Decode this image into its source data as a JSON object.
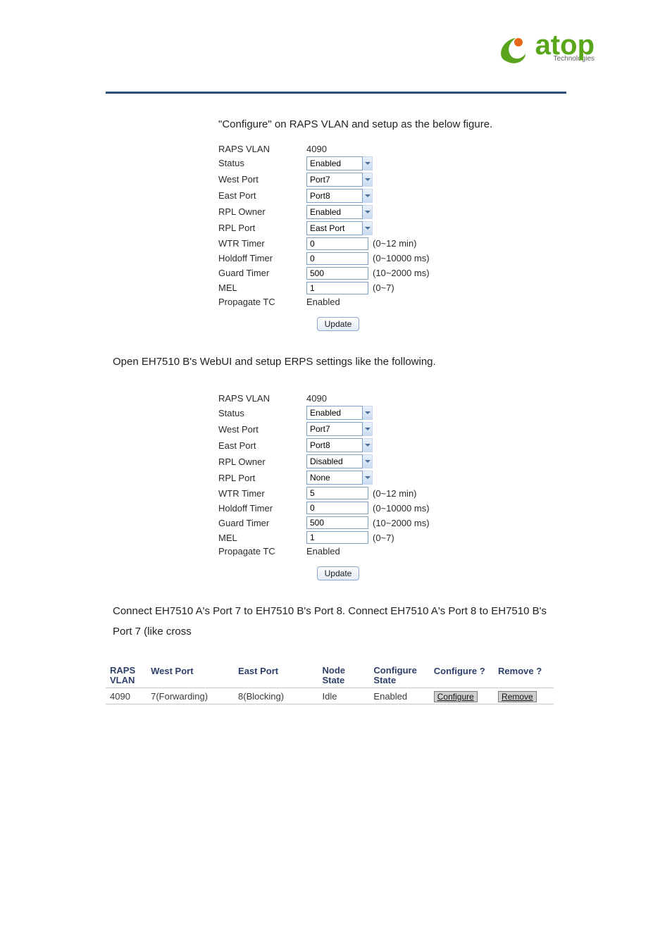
{
  "brand": {
    "name": "atop",
    "sub": "Technologies"
  },
  "text": {
    "intro1": "\"Configure\" on RAPS VLAN and setup as the below figure.",
    "intro2": "Open EH7510 B's WebUI and setup ERPS settings like the following.",
    "intro3": "Connect EH7510 A's Port 7 to EH7510 B's Port 8. Connect EH7510 A's Port 8 to EH7510 B's Port 7 (like cross"
  },
  "formA": {
    "raps_vlan": {
      "label": "RAPS VLAN",
      "value": "4090"
    },
    "status": {
      "label": "Status",
      "value": "Enabled"
    },
    "west_port": {
      "label": "West Port",
      "value": "Port7"
    },
    "east_port": {
      "label": "East Port",
      "value": "Port8"
    },
    "rpl_owner": {
      "label": "RPL Owner",
      "value": "Enabled"
    },
    "rpl_port": {
      "label": "RPL Port",
      "value": "East Port"
    },
    "wtr_timer": {
      "label": "WTR Timer",
      "value": "0",
      "hint": "(0~12 min)"
    },
    "holdoff": {
      "label": "Holdoff Timer",
      "value": "0",
      "hint": "(0~10000 ms)"
    },
    "guard": {
      "label": "Guard Timer",
      "value": "500",
      "hint": "(10~2000 ms)"
    },
    "mel": {
      "label": "MEL",
      "value": "1",
      "hint": "(0~7)"
    },
    "propagate": {
      "label": "Propagate TC",
      "value": "Enabled"
    },
    "update": "Update"
  },
  "formB": {
    "raps_vlan": {
      "label": "RAPS VLAN",
      "value": "4090"
    },
    "status": {
      "label": "Status",
      "value": "Enabled"
    },
    "west_port": {
      "label": "West Port",
      "value": "Port7"
    },
    "east_port": {
      "label": "East Port",
      "value": "Port8"
    },
    "rpl_owner": {
      "label": "RPL Owner",
      "value": "Disabled"
    },
    "rpl_port": {
      "label": "RPL Port",
      "value": "None"
    },
    "wtr_timer": {
      "label": "WTR Timer",
      "value": "5",
      "hint": "(0~12 min)"
    },
    "holdoff": {
      "label": "Holdoff Timer",
      "value": "0",
      "hint": "(0~10000 ms)"
    },
    "guard": {
      "label": "Guard Timer",
      "value": "500",
      "hint": "(10~2000 ms)"
    },
    "mel": {
      "label": "MEL",
      "value": "1",
      "hint": "(0~7)"
    },
    "propagate": {
      "label": "Propagate TC",
      "value": "Enabled"
    },
    "update": "Update"
  },
  "status_table": {
    "headers": {
      "raps": "RAPS VLAN",
      "west": "West Port",
      "east": "East Port",
      "node": "Node State",
      "conf": "Configure State",
      "confq": "Configure ?",
      "remq": "Remove ?"
    },
    "row": {
      "raps": "4090",
      "west": "7(Forwarding)",
      "east": "8(Blocking)",
      "node": "Idle",
      "conf": "Enabled",
      "conf_btn": "Configure",
      "rem_btn": "Remove"
    }
  }
}
